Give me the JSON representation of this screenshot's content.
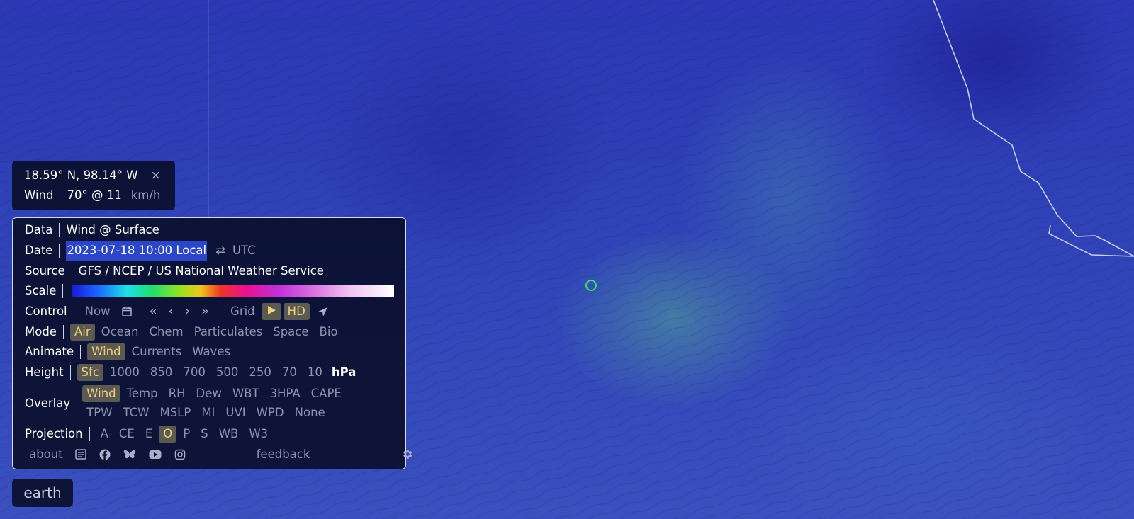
{
  "location": {
    "coords": "18.59° N, 98.14° W",
    "close_icon": "×",
    "wind_label": "Wind",
    "wind_value": "70° @ 11",
    "wind_unit": "km/h"
  },
  "menu": {
    "data_label": "Data",
    "data_value": "Wind @ Surface",
    "date_label": "Date",
    "date_value": "2023-07-18 10:00 Local",
    "swap_icon": "⇄",
    "date_alt": "UTC",
    "source_label": "Source",
    "source_value": "GFS / NCEP / US National Weather Service",
    "scale_label": "Scale",
    "control_label": "Control",
    "control": {
      "now": "Now",
      "first": "«",
      "prev": "‹",
      "next": "›",
      "last": "»",
      "grid": "Grid",
      "hd": "HD"
    },
    "mode_label": "Mode",
    "modes": [
      "Air",
      "Ocean",
      "Chem",
      "Particulates",
      "Space",
      "Bio"
    ],
    "animate_label": "Animate",
    "animate": [
      "Wind",
      "Currents",
      "Waves"
    ],
    "height_label": "Height",
    "heights": [
      "Sfc",
      "1000",
      "850",
      "700",
      "500",
      "250",
      "70",
      "10"
    ],
    "height_unit": "hPa",
    "overlay_label": "Overlay",
    "overlays_row1": [
      "Wind",
      "Temp",
      "RH",
      "Dew",
      "WBT",
      "3HPA",
      "CAPE"
    ],
    "overlays_row2": [
      "TPW",
      "TCW",
      "MSLP",
      "MI",
      "UVI",
      "WPD",
      "None"
    ],
    "projection_label": "Projection",
    "projections": [
      "A",
      "CE",
      "E",
      "O",
      "P",
      "S",
      "WB",
      "W3"
    ],
    "about": "about",
    "feedback": "feedback"
  },
  "footer_label": "earth",
  "colors": {
    "active_text": "#f2d07b",
    "marker": "#37e06b",
    "accent_highlight": "#2b46c9"
  }
}
